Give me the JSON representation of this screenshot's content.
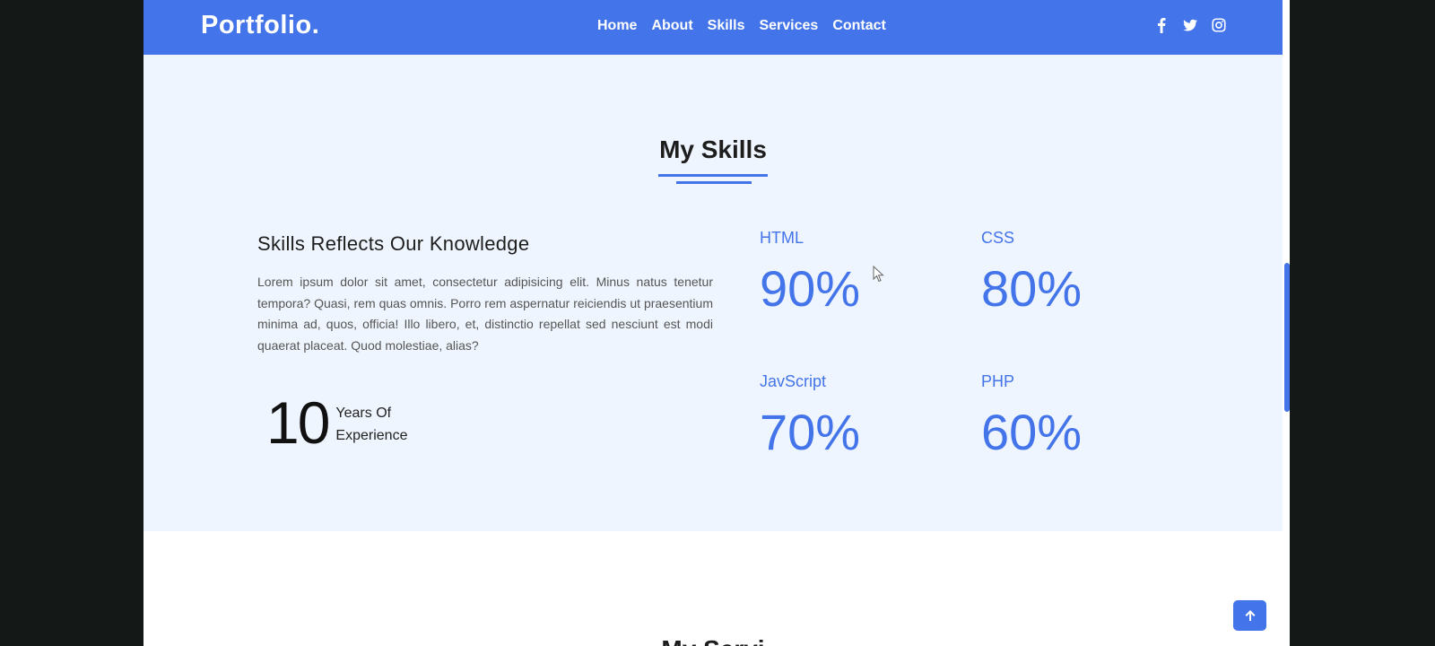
{
  "header": {
    "brand": "Portfolio.",
    "nav": [
      "Home",
      "About",
      "Skills",
      "Services",
      "Contact"
    ],
    "social_icons": [
      "facebook-icon",
      "twitter-icon",
      "instagram-icon"
    ]
  },
  "skills_section": {
    "title": "My Skills",
    "subheading": "Skills Reflects Our Knowledge",
    "paragraph": "Lorem ipsum dolor sit amet, consectetur adipisicing elit. Minus natus tenetur tempora? Quasi, rem quas omnis. Porro rem aspernatur reiciendis ut praesentium minima ad, quos, officia! Illo libero, et, distinctio repellat sed nesciunt est modi quaerat placeat. Quod molestiae, alias?",
    "years_number": "10",
    "years_label_line1": "Years Of",
    "years_label_line2": "Experience",
    "skills": [
      {
        "name": "HTML",
        "value": "90%"
      },
      {
        "name": "CSS",
        "value": "80%"
      },
      {
        "name": "JavScript",
        "value": "70%"
      },
      {
        "name": "PHP",
        "value": "60%"
      }
    ]
  },
  "next_section": {
    "title_partial": "My Servi"
  },
  "colors": {
    "accent": "#4374e9",
    "section_bg": "#eff5fe",
    "outer_bg": "#141817"
  },
  "back_to_top_icon": "arrow-up-icon"
}
